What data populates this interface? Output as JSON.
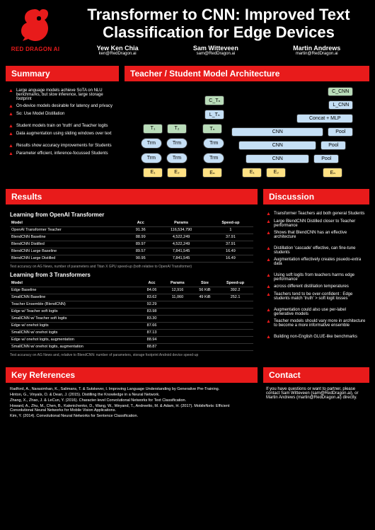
{
  "title": "Transformer to CNN: Improved Text Classification for Edge Devices",
  "logo_text": "RED DRAGON AI",
  "authors": [
    {
      "name": "Yew Ken Chia",
      "email": "ken@RedDragon.ai"
    },
    {
      "name": "Sam Witteveen",
      "email": "sam@RedDragon.ai"
    },
    {
      "name": "Martin Andrews",
      "email": "martin@RedDragon.ai"
    }
  ],
  "sections": {
    "summary": "Summary",
    "arch": "Teacher / Student Model Architecture",
    "results": "Results",
    "discussion": "Discussion",
    "refs": "Key References",
    "contact": "Contact"
  },
  "summary": [
    [
      "Large anguage models achieve SoTA on NLU benchmarks, but slow inference, large storage footprint"
    ],
    [
      "On-device models desirable for latency and privacy"
    ],
    [
      "So: Use Model Distillation"
    ],
    [],
    [
      "Student models train on 'truth' and Teacher logits"
    ],
    [
      "Data augmentation using sliding windows over text"
    ],
    [],
    [
      "Results show accuracy improvements for Students"
    ],
    [
      "Parameter efficient, inference-focussed Students"
    ]
  ],
  "arch": {
    "teacher": {
      "top": "C_Tₙ",
      "loss": "L_Tₙ",
      "outs": [
        "T₁",
        "T₂",
        "Tₙ"
      ],
      "trm": "Trm",
      "emb": [
        "E₁",
        "E₂",
        "Eₙ"
      ]
    },
    "student": {
      "top": "C_CNN",
      "loss": "L_CNN",
      "concat": "Concat + MLP",
      "cnn": "CNN",
      "pool": "Pool",
      "emb": [
        "E₁",
        "E₂",
        "Eₙ"
      ]
    }
  },
  "results": {
    "h1": "Learning from OpenAI Transformer",
    "t1": {
      "cols": [
        "Model",
        "Acc",
        "Params",
        "Speed-up"
      ],
      "rows": [
        [
          "OpenAI Transformer Teacher",
          "91.36",
          "116,534,790",
          "1"
        ],
        [
          "BlendCNN Baseline",
          "88.99",
          "4,522,249",
          "37.91"
        ],
        [
          "BlendCNN Distilled",
          "89.97",
          "4,522,249",
          "37.91"
        ],
        [
          "BlendCNN Large Baseline",
          "89.57",
          "7,841,545",
          "16.49"
        ],
        [
          "BlendCNN Large Distilled",
          "90.95",
          "7,841,545",
          "16.49"
        ]
      ],
      "cap": "Test accuracy on AG News, number of parameters and Titan X GPU speed-up (both relative to OpenAI Transformer)"
    },
    "h2": "Learning from 3 Transformers",
    "t2": {
      "cols": [
        "Model",
        "Acc",
        "Params",
        "Size",
        "Speed-up"
      ],
      "rows": [
        [
          "Edge Baseline",
          "84.06",
          "12,916",
          "56 KiB",
          "392.2"
        ],
        [
          "SmallCNN Baseline",
          "83.62",
          "11,060",
          "49 KiB",
          "252.1"
        ],
        [
          "Teacher Ensemble (BlendCNN)",
          "92.29",
          "",
          "",
          ""
        ],
        [
          "Edge w/ Teacher soft logits",
          "83.98",
          "",
          "",
          ""
        ],
        [
          "SmallCNN w/ Teacher soft logits",
          "83.30",
          "",
          "",
          ""
        ],
        [
          "Edge w/ onehot logits",
          "87.66",
          "",
          "",
          ""
        ],
        [
          "SmallCNN w/ onehot logits",
          "87.13",
          "",
          "",
          ""
        ],
        [
          "Edge w/ onehot logits, augmentation",
          "88.94",
          "",
          "",
          ""
        ],
        [
          "SmallCNN w/ onehot logits, augmentation",
          "88.87",
          "",
          "",
          ""
        ]
      ],
      "cap": "Test accuracy on AG News and, relative to BlendCNN: number of parameters, storage footprint Android device speed-up"
    }
  },
  "discussion": [
    "Transformer Teachers aid both general Students",
    "Large BlendCNN Distilled closer to Teacher performance",
    "Shows that BlendCNN has an effective architecture",
    "",
    "Distillation 'cascade' effective, can fine-tune students",
    "Augmentation effectively creates psuedo-extra data",
    "",
    "Using soft logits from teachers harms edge performance",
    "across different distillation temperatures",
    "Teachers tend to be over-confident : Edge students match 'truth' > soft logit losses",
    "",
    "Augmentation could also use per-label generative models",
    "Teacher models should vary more in architecture to become a more informative ensemble",
    "",
    "Building non-English GLUE-like benchmarks"
  ],
  "refs": [
    "Radford, A., Narasimhan, K., Salimans, T. & Sutskever, I. Improving Language Understanding by Generative Pre-Training.",
    "Hinton, G., Vinyals, O. & Dean, J. (2015). Distilling the Knowledge in a Neural Network.",
    "Zhang, X., Zhao, J. & LeCun, Y. (2016). Character-level Convolutional Networks for Text Classification.",
    "Howard, A., Zhu, M., Chen, B., Kalenichenko, D., Wang, W., Weyand, T., Andreetto, M. & Adam, H. (2017). MobileNets: Efficient Convolutional Neural Networks for Mobile Vision Applications.",
    "Kim, Y. (2014). Convolutional Neural Networks for Sentence Classification."
  ],
  "contact": "If you have questions or want to partner, please contact Sam Witteveen (sam@RedDragon.ai), or Martin Andrews (martin@RedDragon.ai) directly."
}
